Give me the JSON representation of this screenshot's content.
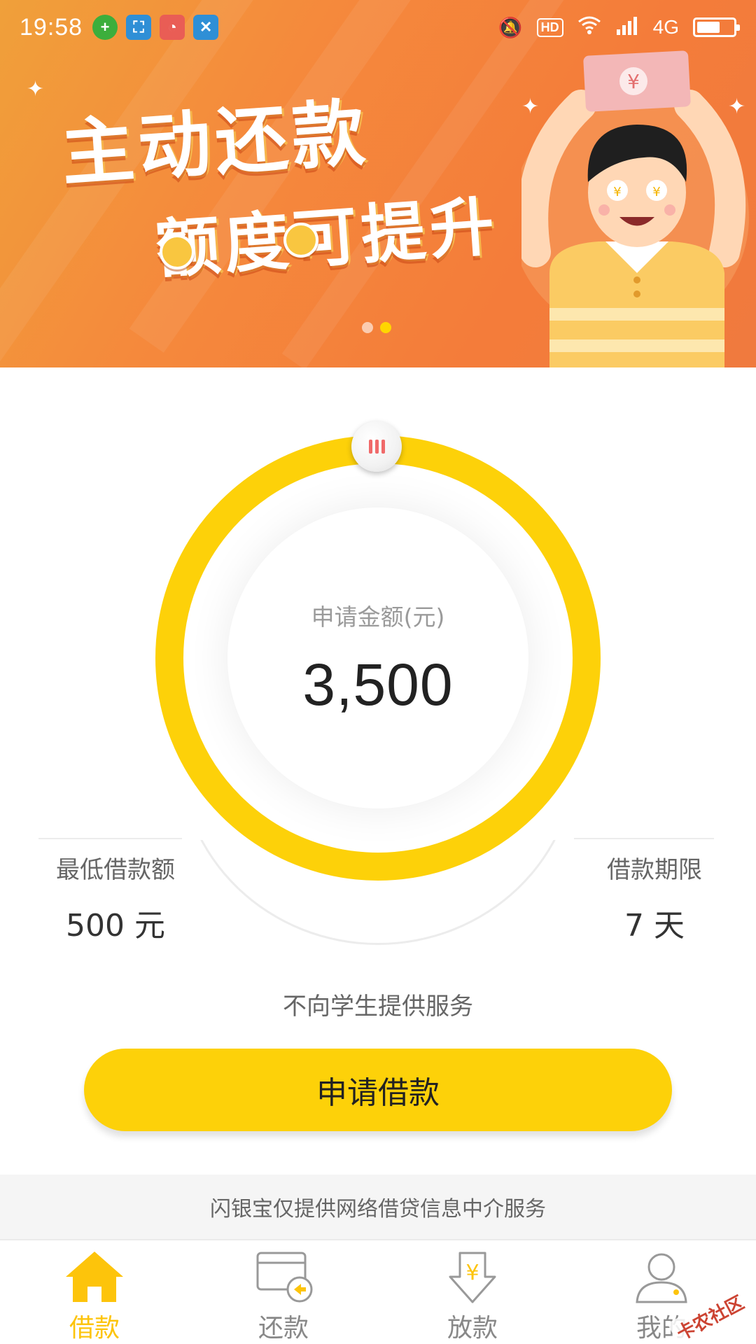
{
  "status_bar": {
    "time": "19:58",
    "hd": "HD",
    "network": "4G",
    "battery_level": 0.58
  },
  "banner": {
    "headline_line1": "主动还款",
    "headline_line2": "额度可提升",
    "slides": 2,
    "active_slide": 2,
    "note_symbol": "¥"
  },
  "dial": {
    "label": "申请金额(元)",
    "amount": "3,500"
  },
  "min_loan": {
    "label": "最低借款额",
    "value": "500 元"
  },
  "loan_term": {
    "label": "借款期限",
    "value": "7 天"
  },
  "notice": "不向学生提供服务",
  "apply_button": "申请借款",
  "disclaimer": "闪银宝仅提供网络借贷信息中介服务",
  "tabs": [
    {
      "label": "借款",
      "icon": "home-icon",
      "active": true
    },
    {
      "label": "还款",
      "icon": "card-repay-icon",
      "active": false
    },
    {
      "label": "放款",
      "icon": "yuan-download-icon",
      "active": false
    },
    {
      "label": "我的",
      "icon": "user-icon",
      "active": false
    }
  ],
  "watermark": "卡农社区",
  "colors": {
    "accent": "#fdd109",
    "banner_orange": "#f47c3a",
    "active_tab": "#fdc40b"
  }
}
